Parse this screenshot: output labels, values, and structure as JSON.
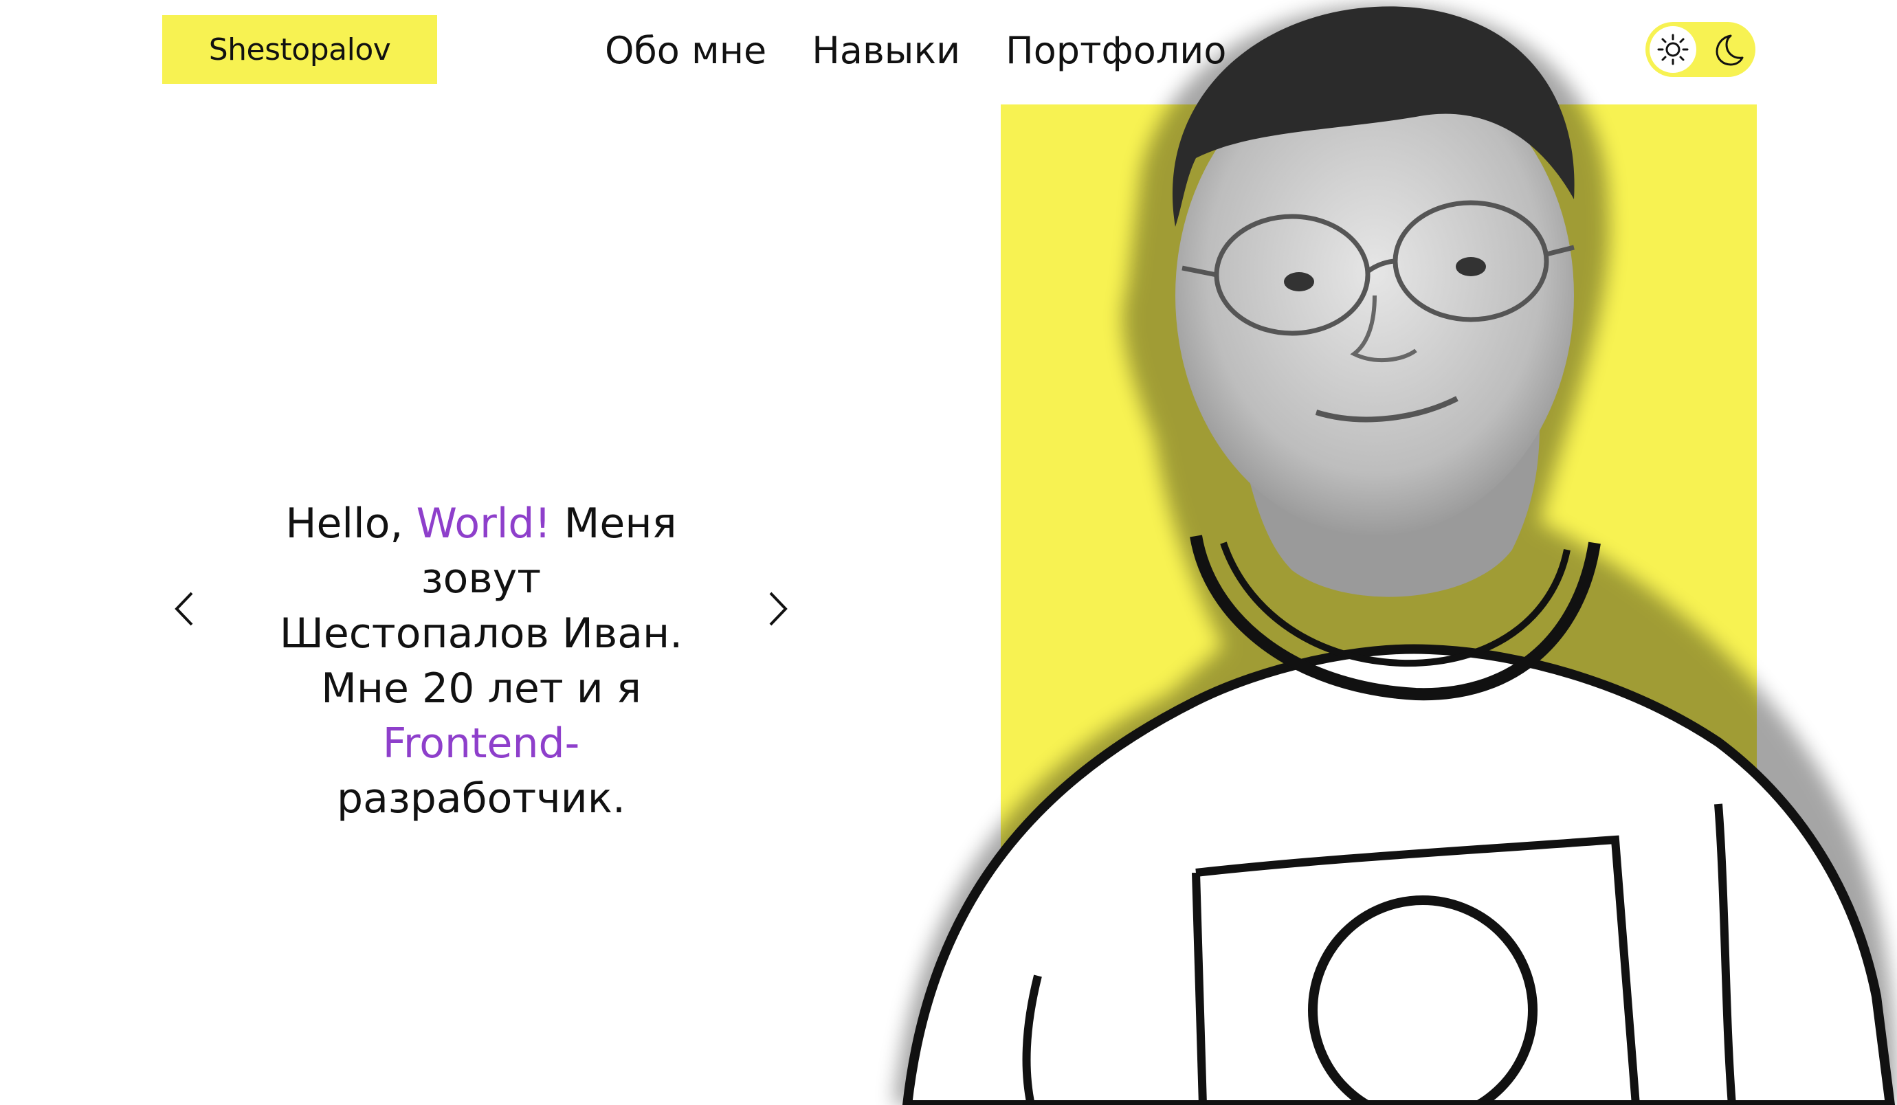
{
  "header": {
    "logo": "Shestopalov",
    "nav": [
      {
        "label": "Обо мне"
      },
      {
        "label": "Навыки"
      },
      {
        "label": "Портфолио"
      }
    ]
  },
  "theme_toggle": {
    "light_icon": "sun-icon",
    "dark_icon": "moon-icon",
    "selected": "light"
  },
  "hero": {
    "line1_a": "Hello, ",
    "line1_accent": "World!",
    "line1_b": " Меня зовут",
    "line2": "Шестопалов Иван.",
    "line3_a": "Мне 20 лет и я ",
    "line3_accent": "Frontend-",
    "line4": "разработчик.",
    "prev_icon": "chevron-left-icon",
    "next_icon": "chevron-right-icon"
  },
  "colors": {
    "accent": "#8e3fcb",
    "brand_yellow": "#f7f252",
    "text": "#111111",
    "background": "#ffffff"
  }
}
